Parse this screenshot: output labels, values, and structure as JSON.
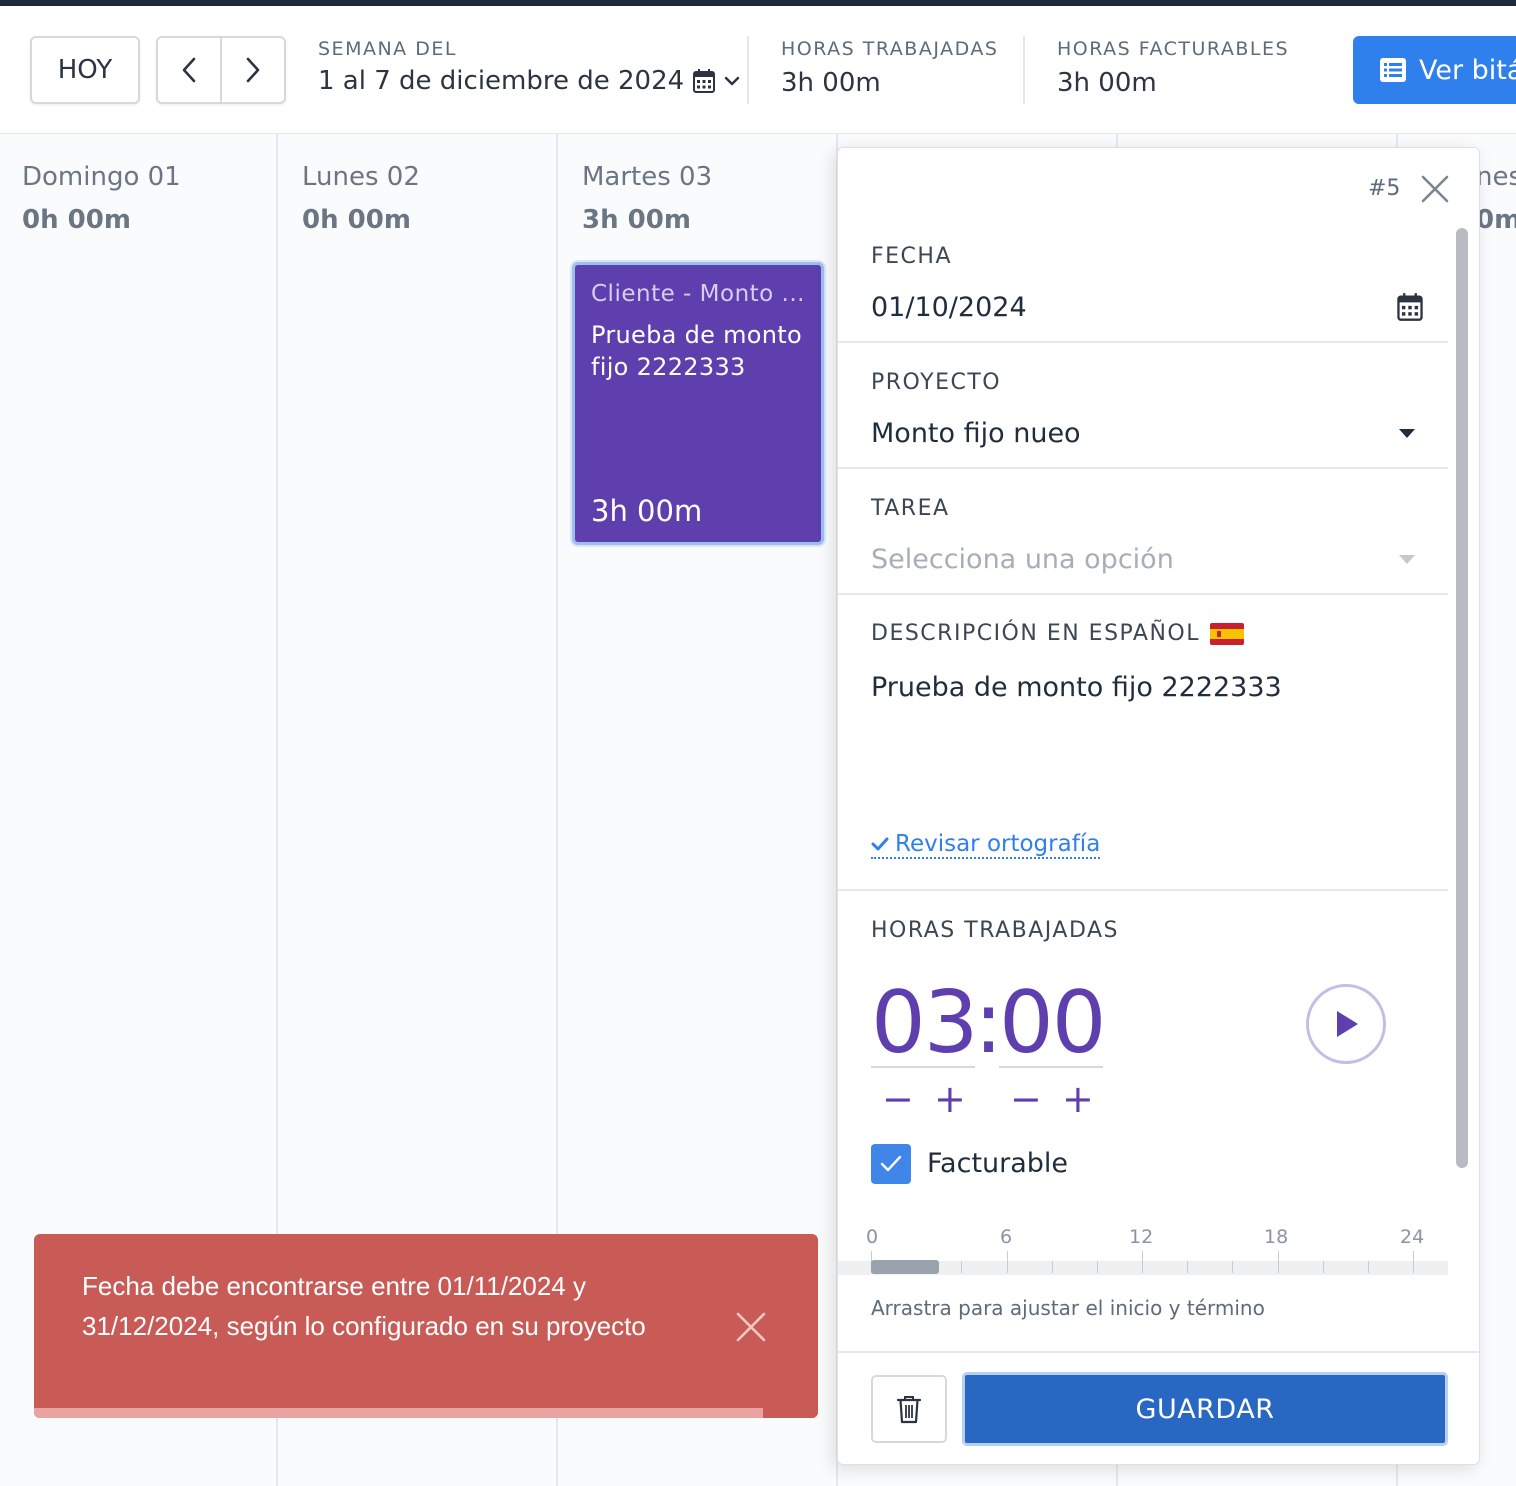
{
  "header": {
    "today_label": "HOY",
    "week_label": "SEMANA DEL",
    "week_value": "1 al 7 de diciembre de 2024",
    "worked_label": "HORAS TRABAJADAS",
    "worked_value": "3h 00m",
    "billable_label": "HORAS FACTURABLES",
    "billable_value": "3h 00m",
    "log_button_label": "Ver bitá"
  },
  "calendar": {
    "days": [
      {
        "name": "Domingo 01",
        "hours": "0h 00m"
      },
      {
        "name": "Lunes 02",
        "hours": "0h 00m"
      },
      {
        "name": "Martes 03",
        "hours": "3h 00m"
      },
      {
        "name": "nes",
        "hours": "0m"
      }
    ],
    "event": {
      "client": "Cliente - Monto ...",
      "description": "Prueba de monto fijo 2222333",
      "duration": "3h 00m"
    }
  },
  "panel": {
    "entry_id": "#5",
    "date_label": "FECHA",
    "date_value": "01/10/2024",
    "project_label": "PROYECTO",
    "project_value": "Monto fijo nueo",
    "task_label": "TAREA",
    "task_placeholder": "Selecciona una opción",
    "description_label": "DESCRIPCIÓN EN ESPAÑOL",
    "description_value": "Prueba de monto fijo 2222333",
    "spellcheck_label": "Revisar ortografía",
    "hours_label": "HORAS TRABAJADAS",
    "hours_value": "03",
    "separator": ":",
    "minutes_value": "00",
    "minus_symbol": "−",
    "plus_symbol": "+",
    "billable_label": "Facturable",
    "billable_checked": true,
    "timeline_ticks": [
      "0",
      "6",
      "12",
      "18",
      "24"
    ],
    "timeline_hint": "Arrastra para ajustar el inicio y término",
    "save_label": "GUARDAR"
  },
  "toast": {
    "message": "Fecha debe encontrarse entre 01/11/2024 y 31/12/2024, según lo configurado en su proyecto",
    "progress_fraction": 0.93
  },
  "colors": {
    "accent_purple": "#5e3fad",
    "primary_blue": "#2f80ed",
    "save_blue": "#2868c2",
    "toast_red": "#c95b57"
  }
}
